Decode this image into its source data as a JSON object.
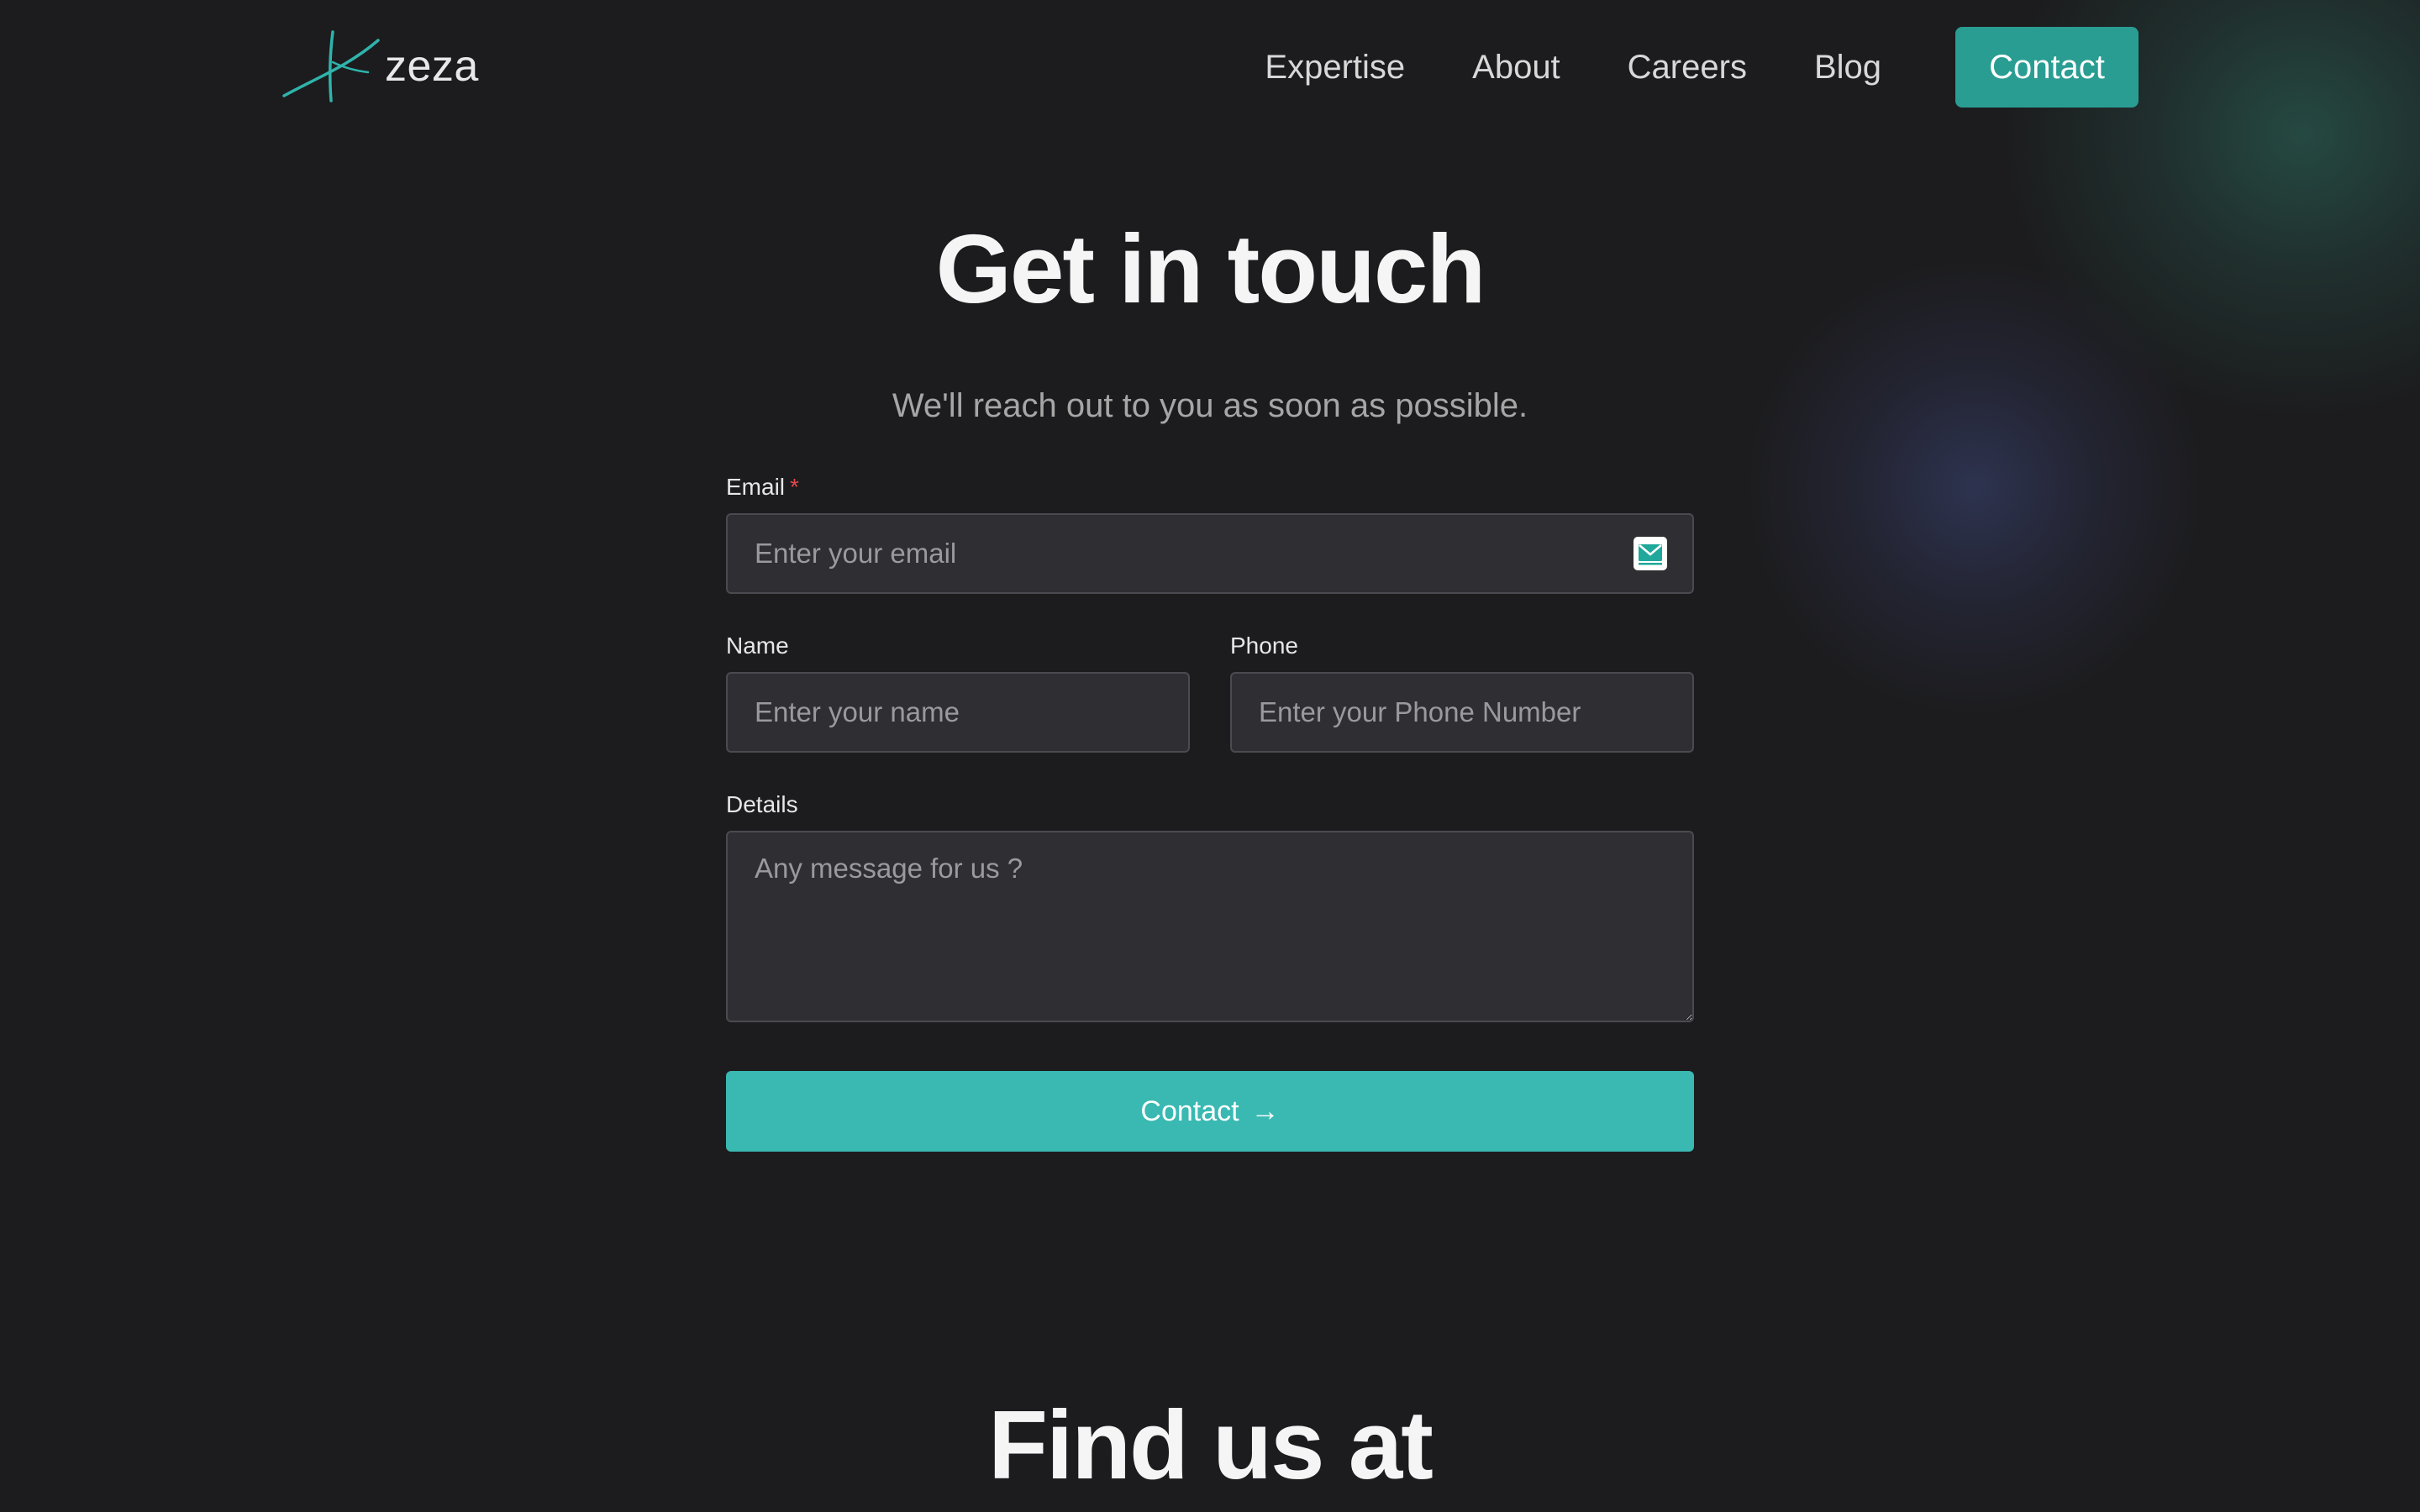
{
  "brand": {
    "name": "zeza",
    "accent": "#2a9d93",
    "button_color": "#3ab9b2",
    "background": "#1c1c1e"
  },
  "nav": {
    "items": [
      {
        "label": "Expertise"
      },
      {
        "label": "About"
      },
      {
        "label": "Careers"
      },
      {
        "label": "Blog"
      }
    ],
    "cta_label": "Contact"
  },
  "hero": {
    "title": "Get in touch",
    "subtitle": "We'll reach out to you as soon as possible."
  },
  "form": {
    "email": {
      "label": "Email",
      "required_mark": "*",
      "placeholder": "Enter your email",
      "value": "",
      "icon": "email-envelope-icon"
    },
    "name": {
      "label": "Name",
      "placeholder": "Enter your name",
      "value": ""
    },
    "phone": {
      "label": "Phone",
      "placeholder": "Enter your Phone Number",
      "value": ""
    },
    "details": {
      "label": "Details",
      "placeholder": "Any message for us ?",
      "value": ""
    },
    "submit_label": "Contact",
    "submit_icon": "arrow-right-icon"
  },
  "location": {
    "title": "Find us at"
  }
}
